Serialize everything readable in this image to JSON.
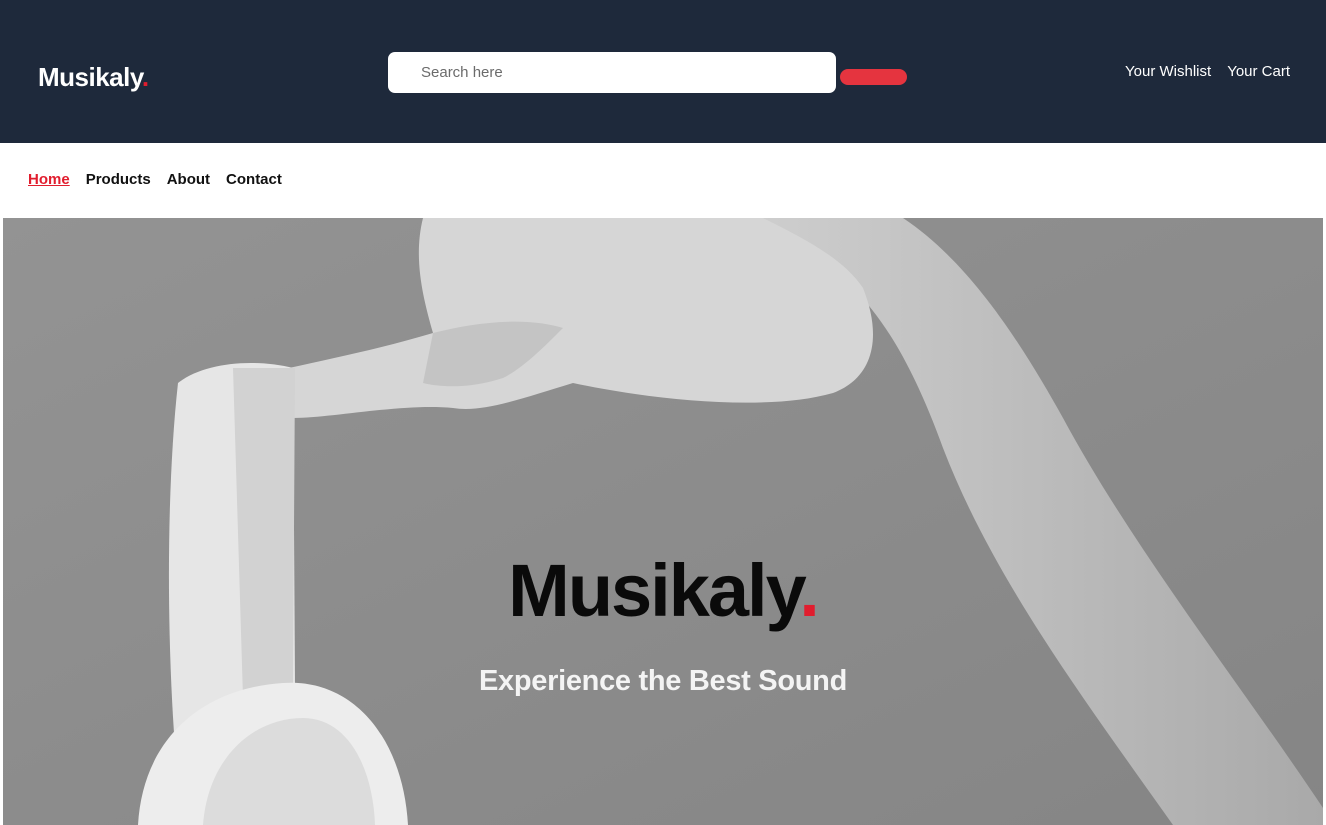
{
  "brand": {
    "name": "Musikaly",
    "dot": "."
  },
  "search": {
    "placeholder": "Search here"
  },
  "header_links": {
    "wishlist": "Your Wishlist",
    "cart": "Your Cart"
  },
  "nav": {
    "items": [
      {
        "label": "Home",
        "active": true
      },
      {
        "label": "Products"
      },
      {
        "label": "About"
      },
      {
        "label": "Contact"
      }
    ]
  },
  "hero": {
    "title": "Musikaly",
    "dot": ".",
    "subtitle": "Experience the Best Sound"
  },
  "colors": {
    "header_bg": "#1e293b",
    "accent": "#e11d2e",
    "hero_bg": "#8e8e8e"
  }
}
